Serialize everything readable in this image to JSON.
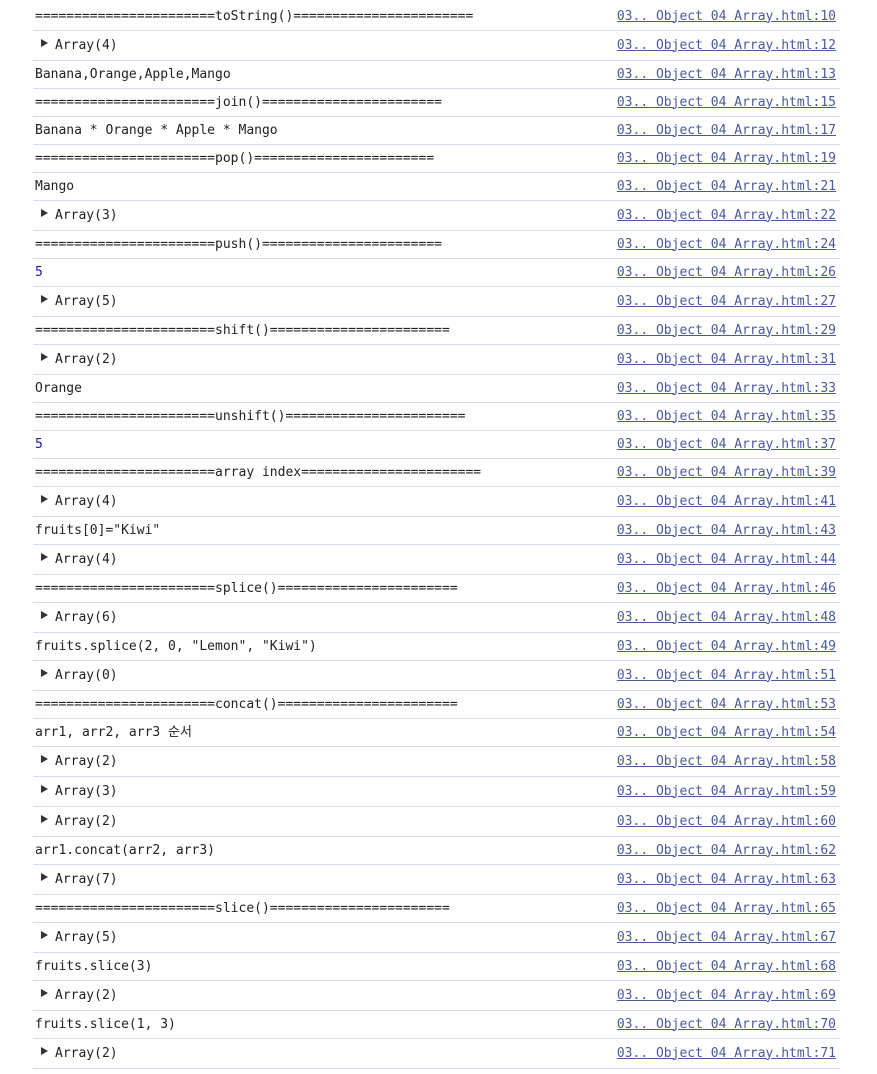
{
  "console": {
    "rows": [
      {
        "kind": "text",
        "text": "=======================toString()=======================",
        "source": "03.. Object 04 Array.html:10"
      },
      {
        "kind": "object",
        "text": "Array(4)",
        "source": "03.. Object 04 Array.html:12"
      },
      {
        "kind": "text",
        "text": "Banana,Orange,Apple,Mango",
        "source": "03.. Object 04 Array.html:13"
      },
      {
        "kind": "text",
        "text": "=======================join()=======================",
        "source": "03.. Object 04 Array.html:15"
      },
      {
        "kind": "text",
        "text": "Banana * Orange * Apple * Mango",
        "source": "03.. Object 04 Array.html:17"
      },
      {
        "kind": "text",
        "text": "=======================pop()=======================",
        "source": "03.. Object 04 Array.html:19"
      },
      {
        "kind": "text",
        "text": "Mango",
        "source": "03.. Object 04 Array.html:21"
      },
      {
        "kind": "object",
        "text": "Array(3)",
        "source": "03.. Object 04 Array.html:22"
      },
      {
        "kind": "text",
        "text": "=======================push()=======================",
        "source": "03.. Object 04 Array.html:24"
      },
      {
        "kind": "number",
        "text": "5",
        "source": "03.. Object 04 Array.html:26"
      },
      {
        "kind": "object",
        "text": "Array(5)",
        "source": "03.. Object 04 Array.html:27"
      },
      {
        "kind": "text",
        "text": "=======================shift()=======================",
        "source": "03.. Object 04 Array.html:29"
      },
      {
        "kind": "object",
        "text": "Array(2)",
        "source": "03.. Object 04 Array.html:31"
      },
      {
        "kind": "text",
        "text": "Orange",
        "source": "03.. Object 04 Array.html:33"
      },
      {
        "kind": "text",
        "text": "=======================unshift()=======================",
        "source": "03.. Object 04 Array.html:35"
      },
      {
        "kind": "number",
        "text": "5",
        "source": "03.. Object 04 Array.html:37"
      },
      {
        "kind": "text",
        "text": "=======================array index=======================",
        "source": "03.. Object 04 Array.html:39"
      },
      {
        "kind": "object",
        "text": "Array(4)",
        "source": "03.. Object 04 Array.html:41"
      },
      {
        "kind": "text",
        "text": "fruits[0]=\"Kiwi\"",
        "source": "03.. Object 04 Array.html:43"
      },
      {
        "kind": "object",
        "text": "Array(4)",
        "source": "03.. Object 04 Array.html:44"
      },
      {
        "kind": "text",
        "text": "=======================splice()=======================",
        "source": "03.. Object 04 Array.html:46"
      },
      {
        "kind": "object",
        "text": "Array(6)",
        "source": "03.. Object 04 Array.html:48"
      },
      {
        "kind": "text",
        "text": "fruits.splice(2, 0, \"Lemon\", \"Kiwi\")",
        "source": "03.. Object 04 Array.html:49"
      },
      {
        "kind": "object",
        "text": "Array(0)",
        "source": "03.. Object 04 Array.html:51"
      },
      {
        "kind": "text",
        "text": "=======================concat()=======================",
        "source": "03.. Object 04 Array.html:53"
      },
      {
        "kind": "text",
        "text": "arr1, arr2, arr3 순서",
        "source": "03.. Object 04 Array.html:54"
      },
      {
        "kind": "object",
        "text": "Array(2)",
        "source": "03.. Object 04 Array.html:58"
      },
      {
        "kind": "object",
        "text": "Array(3)",
        "source": "03.. Object 04 Array.html:59"
      },
      {
        "kind": "object",
        "text": "Array(2)",
        "source": "03.. Object 04 Array.html:60"
      },
      {
        "kind": "text",
        "text": "arr1.concat(arr2, arr3)",
        "source": "03.. Object 04 Array.html:62"
      },
      {
        "kind": "object",
        "text": "Array(7)",
        "source": "03.. Object 04 Array.html:63"
      },
      {
        "kind": "text",
        "text": "=======================slice()=======================",
        "source": "03.. Object 04 Array.html:65"
      },
      {
        "kind": "object",
        "text": "Array(5)",
        "source": "03.. Object 04 Array.html:67"
      },
      {
        "kind": "text",
        "text": "fruits.slice(3)",
        "source": "03.. Object 04 Array.html:68"
      },
      {
        "kind": "object",
        "text": "Array(2)",
        "source": "03.. Object 04 Array.html:69"
      },
      {
        "kind": "text",
        "text": "fruits.slice(1, 3)",
        "source": "03.. Object 04 Array.html:70"
      },
      {
        "kind": "object",
        "text": "Array(2)",
        "source": "03.. Object 04 Array.html:71"
      }
    ]
  },
  "colors": {
    "text": "#222222",
    "link": "#4a5a9a",
    "number": "#1a1aa6",
    "separator": "#d3deec"
  }
}
